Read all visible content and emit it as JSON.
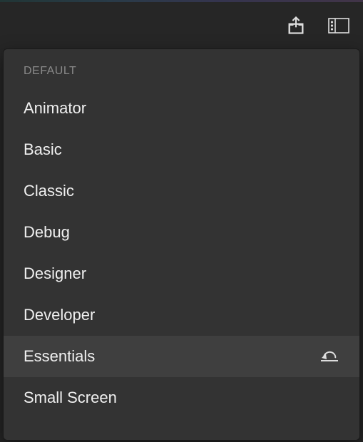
{
  "menu": {
    "section_label": "DEFAULT",
    "items": [
      {
        "label": "Animator",
        "hovered": false,
        "has_reset": false
      },
      {
        "label": "Basic",
        "hovered": false,
        "has_reset": false
      },
      {
        "label": "Classic",
        "hovered": false,
        "has_reset": false
      },
      {
        "label": "Debug",
        "hovered": false,
        "has_reset": false
      },
      {
        "label": "Designer",
        "hovered": false,
        "has_reset": false
      },
      {
        "label": "Developer",
        "hovered": false,
        "has_reset": false
      },
      {
        "label": "Essentials",
        "hovered": true,
        "has_reset": true
      },
      {
        "label": "Small Screen",
        "hovered": false,
        "has_reset": false
      }
    ]
  }
}
